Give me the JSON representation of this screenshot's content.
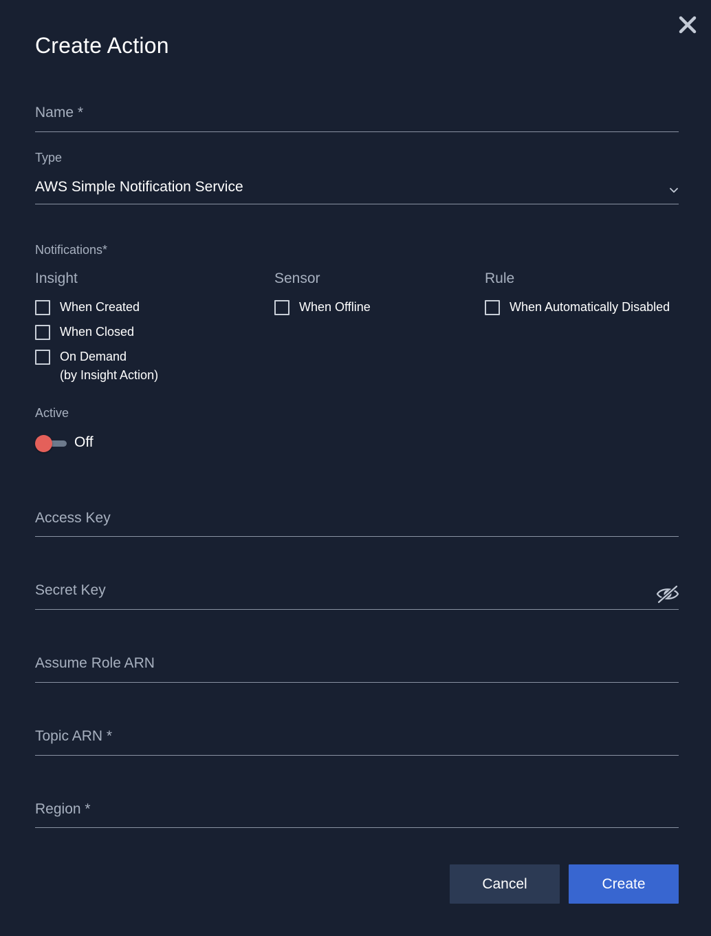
{
  "dialog": {
    "title": "Create Action",
    "close_icon": "close-icon"
  },
  "fields": {
    "name": {
      "placeholder": "Name *"
    },
    "type": {
      "label": "Type",
      "value": "AWS Simple Notification Service",
      "icon": "chevron-down-icon"
    },
    "access_key": {
      "placeholder": "Access Key"
    },
    "secret_key": {
      "placeholder": "Secret Key",
      "icon": "eye-slash-icon"
    },
    "assume_role_arn": {
      "placeholder": "Assume Role ARN"
    },
    "topic_arn": {
      "placeholder": "Topic ARN *"
    },
    "region": {
      "placeholder": "Region *"
    }
  },
  "notifications": {
    "label": "Notifications*",
    "groups": [
      {
        "heading": "Insight",
        "options": [
          {
            "label": "When Created",
            "checked": false
          },
          {
            "label": "When Closed",
            "checked": false
          },
          {
            "label": "On Demand",
            "sublabel": "(by Insight Action)",
            "checked": false
          }
        ]
      },
      {
        "heading": "Sensor",
        "options": [
          {
            "label": "When Offline",
            "checked": false
          }
        ]
      },
      {
        "heading": "Rule",
        "options": [
          {
            "label": "When Automatically Disabled",
            "checked": false
          }
        ]
      }
    ]
  },
  "active": {
    "label": "Active",
    "state": "Off",
    "on": false
  },
  "buttons": {
    "cancel": "Cancel",
    "create": "Create"
  },
  "colors": {
    "background": "#182031",
    "primary": "#3866d0",
    "secondary_button": "#2c3a54",
    "toggle_off": "#e4605a",
    "muted_text": "#a7b0bf"
  }
}
